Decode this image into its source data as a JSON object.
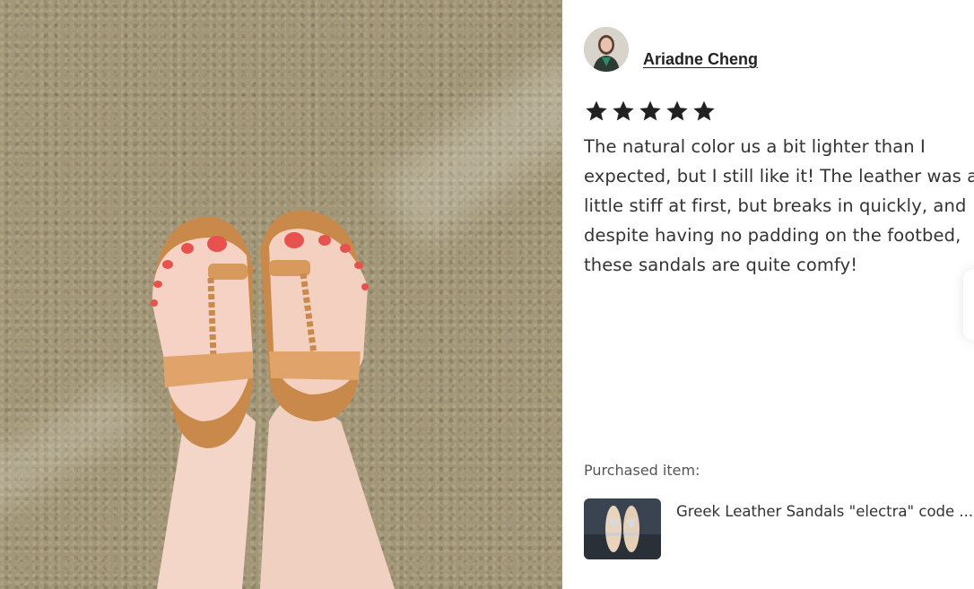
{
  "review": {
    "reviewer_name": "Ariadne Cheng",
    "rating": 5,
    "rating_max": 5,
    "text": "The natural color us a bit lighter than I expected, but I still like it! The leather was a little stiff at first, but breaks in quickly, and despite having no padding on the footbed, these sandals are quite comfy!"
  },
  "purchased": {
    "label": "Purchased item:",
    "item_title": "Greek Leather Sandals \"electra\" code ..."
  },
  "icons": {
    "star": "star-filled-icon"
  },
  "colors": {
    "star": "#222222",
    "text": "#333333",
    "muted": "#555555"
  }
}
